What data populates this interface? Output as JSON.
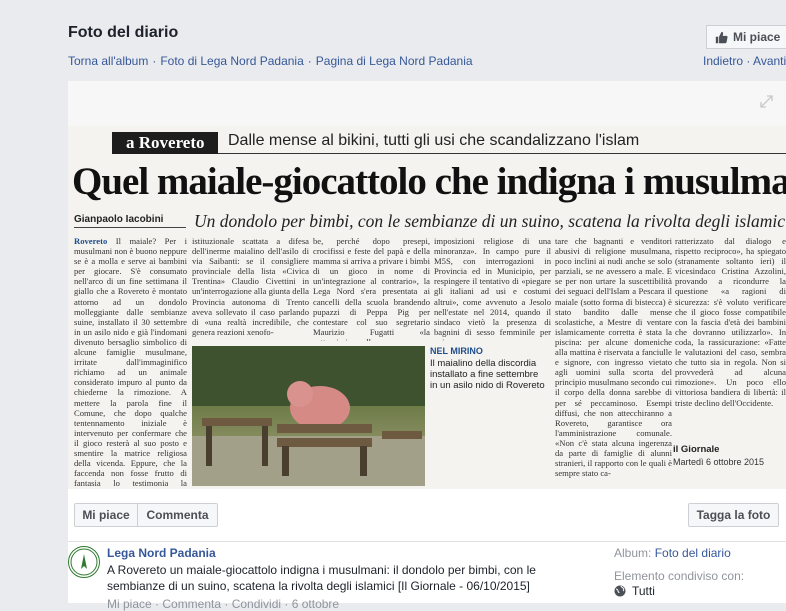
{
  "header": {
    "title": "Foto del diario",
    "like_label": "Mi piace",
    "breadcrumbs": [
      "Torna all'album",
      "Foto di Lega Nord Padania",
      "Pagina di Lega Nord Padania"
    ],
    "separator": "·",
    "next_label": "Indietro",
    "prev_label": "Avanti"
  },
  "article": {
    "section": "a Rovereto",
    "kicker": "Dalle mense al bikini, tutti gli usi che scandalizzano l'islam",
    "headline": "Quel maiale-giocattolo che indigna i musulmani",
    "byline": "Gianpaolo Iacobini",
    "subhead": "Un dondolo per bimbi, con le sembianze di un suino, scatena la rivolta degli islamici",
    "col1_lead": "Rovereto",
    "col1": "Il maiale? Per i musulmani non è buono neppure se è a molla e serve ai bambini per giocare. S'è consumato nell'arco di un fine settimana il giallo che a Rovereto è montato attorno ad un dondolo molleggiante dalle sembianze suine, installato il 30 settembre in un asilo nido e già l'indomani divenuto bersaglio simbolico di alcune famiglie musulmane, irritate dall'immaginifico richiamo ad un animale considerato impuro al punto da chiederne la rimozione. A mettere la parola fine il Comune, che dopo qualche tentennamento iniziale è intervenuto per confermare che il gioco resterà al suo posto e smentire la matrice religiosa della vicenda. Eppure, che la faccenda non fosse frutto di fantasia lo testimonia la mobilitazione politica ed",
    "col2": "istituzionale scattata a difesa dell'inerme maialino dell'asilo di via Saibanti: se il consigliere provinciale della lista «Civica Trentina» Claudio Civettini in un'interrogazione alla giunta della Provincia autonoma di Trento aveva sollevato il caso parlando di «una realtà incredibile, che genera reazioni xenofo-",
    "col3": "be, perché dopo presepi, crocifissi e feste del papà e della mamma si arriva a privare i bimbi di un gioco in nome di un'integrazione al contrario», la Lega Nord s'era presentata ai cancelli della scuola brandendo pupazzi di Peppa Pig per contestare col suo segretario Maurizio Fugatti «la sottomissione alle",
    "col4": "imposizioni religiose di una minoranza». In campo pure il M5S, con interrogazioni in Provincia ed in Municipio, per respingere il tentativo di «piegare gli italiani ad usi e costumi altrui», come avvenuto a Jesolo nell'estate nel 2014, quando il sindaco vietò la presenza di bagnini di sesso femminile per evi-",
    "col5": "tare che bagnanti e venditori abusivi di religione musulmana, poco inclini ai nudi anche se solo parziali, se ne avessero a male. E se per non urtare la suscettibilità dei seguaci dell'Islam a Pescara il maiale (sotto forma di bistecca) è stato bandito dalle mense scolastiche, a Mestre di ventare islamicamente corretta è stata la piscina: per alcune domeniche alla mattina è riservata a fanciulle e signore, con ingresso vietato agli uomini sulla scorta del principio musulmano secondo cui il corpo della donna sarebbe di per sé peccaminoso. Esempi diffusi, che non attecchiranno a Rovereto, garantisce ora l'amministrazione comunale. «Non c'è stata alcuna ingerenza da parte di famiglie di alunni stranieri, il rapporto con le quali è sempre stato ca-",
    "col6": "ratterizzato dal dialogo e rispetto reciproco», ha spiegato (stranamente soltanto ieri) il vicesindaco Cristina Azzolini, provando a ricondurre la questione «a ragioni di sicurezza: s'è voluto verificare che il gioco fosse compatibile con la fascia d'età dei bambini che dovranno utilizzarlo». In coda, la rassicurazione: «Fatte le valutazioni del caso, sembra che tutto sia in regola. Non si provvederà ad alcuna rimozione». Un poco ello vittoriosa bandiera di libertà: il triste declino dell'Occidente.",
    "caption_head": "NEL MIRINO",
    "caption": "Il maialino della discordia installato a fine settembre in un asilo nido di Rovereto",
    "source": "il Giornale",
    "source_date": "Martedì 6 ottobre 2015"
  },
  "actions": {
    "like_label": "Mi piace",
    "comment_label": "Commenta",
    "tag_label": "Tagga la foto"
  },
  "post": {
    "page_name": "Lega Nord Padania",
    "text": "A Rovereto un maiale-giocattolo indigna i musulmani: il dondolo per bimbi, con le sembianze di un suino, scatena la rivolta degli islamici [Il Giornale - 06/10/2015]",
    "links": "Mi piace · Commenta · Condividi · 6 ottobre",
    "album_label": "Album:",
    "album_name": "Foto del diario",
    "shared_label": "Elemento condiviso con:",
    "audience": "Tutti"
  },
  "colors": {
    "link": "#365899",
    "accent_blue": "#1e4d8c",
    "background": "#e9ebee"
  }
}
